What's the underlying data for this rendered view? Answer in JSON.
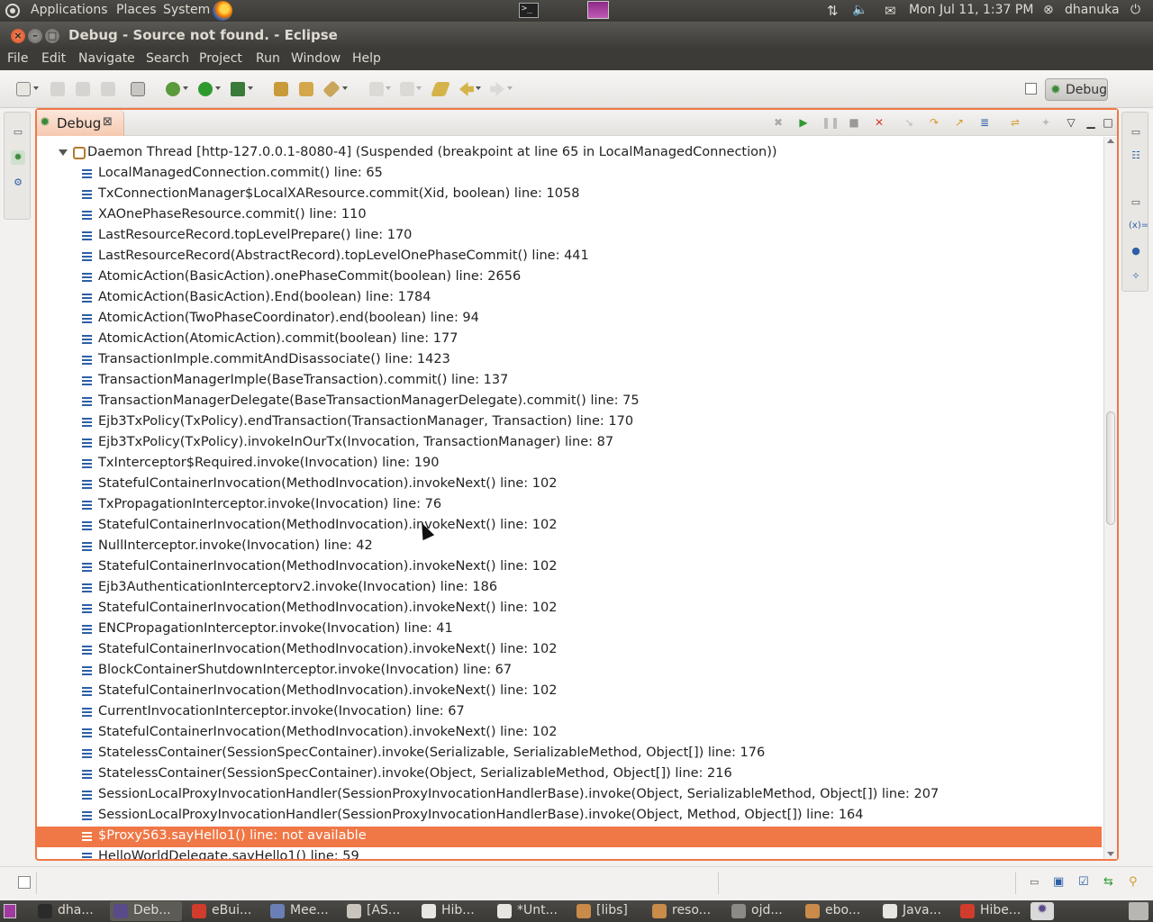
{
  "top_panel": {
    "menus": [
      "Applications",
      "Places",
      "System"
    ],
    "clock": "Mon Jul 11,  1:37 PM",
    "user": "dhanuka"
  },
  "window": {
    "title": "Debug - Source not found. - Eclipse"
  },
  "menu_bar": [
    "File",
    "Edit",
    "Navigate",
    "Search",
    "Project",
    "Run",
    "Window",
    "Help"
  ],
  "perspective": {
    "label": "Debug"
  },
  "debug_view": {
    "tab_label": "Debug",
    "thread": "Daemon Thread [http-127.0.0.1-8080-4] (Suspended (breakpoint at line 65 in LocalManagedConnection))",
    "frames": [
      "LocalManagedConnection.commit() line: 65",
      "TxConnectionManager$LocalXAResource.commit(Xid, boolean) line: 1058",
      "XAOnePhaseResource.commit() line: 110",
      "LastResourceRecord.topLevelPrepare() line: 170",
      "LastResourceRecord(AbstractRecord).topLevelOnePhaseCommit() line: 441",
      "AtomicAction(BasicAction).onePhaseCommit(boolean) line: 2656",
      "AtomicAction(BasicAction).End(boolean) line: 1784",
      "AtomicAction(TwoPhaseCoordinator).end(boolean) line: 94",
      "AtomicAction(AtomicAction).commit(boolean) line: 177",
      "TransactionImple.commitAndDisassociate() line: 1423",
      "TransactionManagerImple(BaseTransaction).commit() line: 137",
      "TransactionManagerDelegate(BaseTransactionManagerDelegate).commit() line: 75",
      "Ejb3TxPolicy(TxPolicy).endTransaction(TransactionManager, Transaction) line: 170",
      "Ejb3TxPolicy(TxPolicy).invokeInOurTx(Invocation, TransactionManager) line: 87",
      "TxInterceptor$Required.invoke(Invocation) line: 190",
      "StatefulContainerInvocation(MethodInvocation).invokeNext() line: 102",
      "TxPropagationInterceptor.invoke(Invocation) line: 76",
      "StatefulContainerInvocation(MethodInvocation).invokeNext() line: 102",
      "NullInterceptor.invoke(Invocation) line: 42",
      "StatefulContainerInvocation(MethodInvocation).invokeNext() line: 102",
      "Ejb3AuthenticationInterceptorv2.invoke(Invocation) line: 186",
      "StatefulContainerInvocation(MethodInvocation).invokeNext() line: 102",
      "ENCPropagationInterceptor.invoke(Invocation) line: 41",
      "StatefulContainerInvocation(MethodInvocation).invokeNext() line: 102",
      "BlockContainerShutdownInterceptor.invoke(Invocation) line: 67",
      "StatefulContainerInvocation(MethodInvocation).invokeNext() line: 102",
      "CurrentInvocationInterceptor.invoke(Invocation) line: 67",
      "StatefulContainerInvocation(MethodInvocation).invokeNext() line: 102",
      "StatelessContainer(SessionSpecContainer).invoke(Serializable, SerializableMethod, Object[]) line: 176",
      "StatelessContainer(SessionSpecContainer).invoke(Object, SerializableMethod, Object[]) line: 216",
      "SessionLocalProxyInvocationHandler(SessionProxyInvocationHandlerBase).invoke(Object, SerializableMethod, Object[]) line: 207",
      "SessionLocalProxyInvocationHandler(SessionProxyInvocationHandlerBase).invoke(Object, Method, Object[]) line: 164",
      "$Proxy563.sayHello1() line: not available",
      "HelloWorldDelegate.sayHello1() line: 59"
    ],
    "selected_index": 32,
    "scroll_position": 0.45
  },
  "taskbar": [
    {
      "label": "dha...",
      "icon": "terminal-icon",
      "color": "#2b2b2b"
    },
    {
      "label": "Deb...",
      "icon": "eclipse-icon",
      "color": "#5b4a8a"
    },
    {
      "label": "eBui...",
      "icon": "chrome-icon",
      "color": "#d23c2c"
    },
    {
      "label": "Mee...",
      "icon": "pidgin-icon",
      "color": "#6a7fb5"
    },
    {
      "label": "[AS...",
      "icon": "document-icon",
      "color": "#c9c5bd"
    },
    {
      "label": "Hib...",
      "icon": "document-icon",
      "color": "#e8e6e1"
    },
    {
      "label": "*Unt...",
      "icon": "text-editor-icon",
      "color": "#e8e6e1"
    },
    {
      "label": "[libs]",
      "icon": "folder-icon",
      "color": "#c98a4a"
    },
    {
      "label": "reso...",
      "icon": "folder-icon",
      "color": "#c98a4a"
    },
    {
      "label": "ojd...",
      "icon": "archive-icon",
      "color": "#8c8a85"
    },
    {
      "label": "ebo...",
      "icon": "folder-icon",
      "color": "#c98a4a"
    },
    {
      "label": "Java...",
      "icon": "document-icon",
      "color": "#e8e6e1"
    },
    {
      "label": "Hibe...",
      "icon": "chrome-icon",
      "color": "#d23c2c"
    }
  ],
  "colors": {
    "selection": "#f07746",
    "frame_icon": "#2d5fa6",
    "panel_bg": "#3c3b37"
  }
}
